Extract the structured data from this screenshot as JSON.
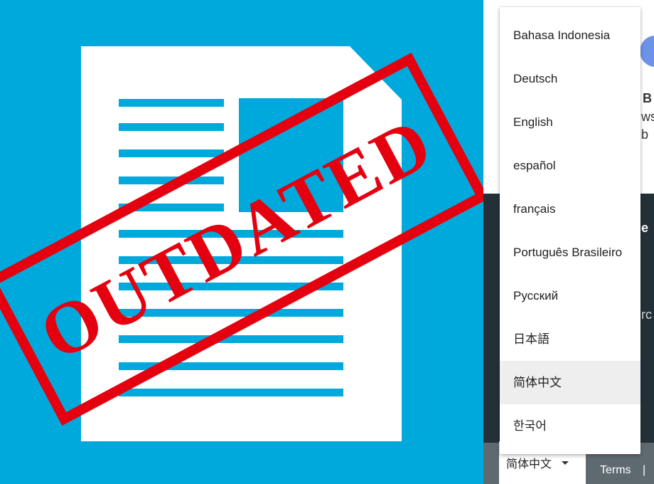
{
  "illustration": {
    "stamp_text": "OUTDATED",
    "colors": {
      "background": "#00a9dc",
      "paper": "#ffffff",
      "doc_lines": "#00a9dc",
      "stamp": "#e4000f"
    }
  },
  "page_fragments": {
    "line_1": "B",
    "line_2": "ws",
    "line_3": "b",
    "dark_line_1": "e",
    "dark_line_2": "rc"
  },
  "language_menu": {
    "items": [
      "Bahasa Indonesia",
      "Deutsch",
      "English",
      "español",
      "français",
      "Português Brasileiro",
      "Русский",
      "日本語",
      "简体中文",
      "한국어"
    ],
    "selected": "简体中文"
  },
  "footer": {
    "language_selector_value": "简体中文",
    "terms_label": "Terms",
    "separator": "|"
  }
}
